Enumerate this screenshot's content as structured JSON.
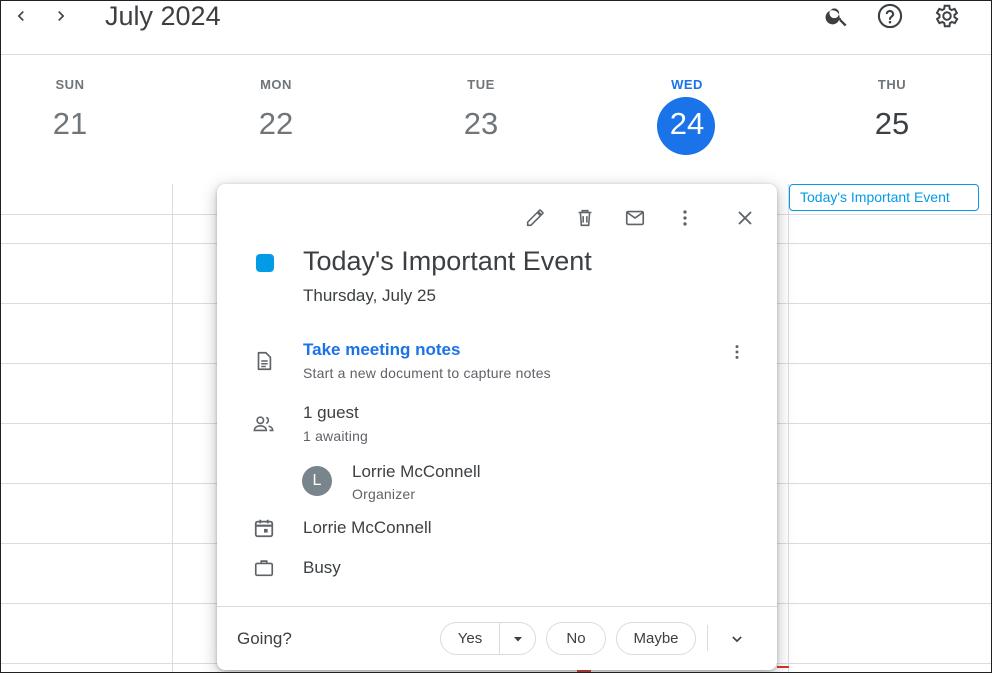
{
  "header": {
    "month_title": "July 2024",
    "prev_icon": "chevron-left-icon",
    "next_icon": "chevron-right-icon",
    "search_icon": "search-icon",
    "help_icon": "help-icon",
    "settings_icon": "gear-icon"
  },
  "days": [
    {
      "dow": "SUN",
      "num": "21"
    },
    {
      "dow": "MON",
      "num": "22"
    },
    {
      "dow": "TUE",
      "num": "23"
    },
    {
      "dow": "WED",
      "num": "24",
      "today": true
    },
    {
      "dow": "THU",
      "num": "25"
    }
  ],
  "event_chip": {
    "label": "Today's Important Event",
    "color": "#039be5"
  },
  "popup": {
    "toolbar": [
      "edit-icon",
      "trash-icon",
      "email-icon",
      "more-vert-icon",
      "close-icon"
    ],
    "event_color": "#039be5",
    "title": "Today's Important Event",
    "date": "Thursday, July 25",
    "notes": {
      "link": "Take meeting notes",
      "subtitle": "Start a new document to capture notes"
    },
    "guests": {
      "count": "1 guest",
      "status": "1 awaiting",
      "list": [
        {
          "initial": "L",
          "name": "Lorrie McConnell",
          "role": "Organizer"
        }
      ]
    },
    "calendar_owner": "Lorrie McConnell",
    "availability": "Busy",
    "rsvp": {
      "prompt": "Going?",
      "yes": "Yes",
      "no": "No",
      "maybe": "Maybe"
    }
  },
  "colors": {
    "accent": "#1a73e8",
    "event": "#039be5",
    "text": "#3c4043",
    "muted": "#70757a"
  }
}
